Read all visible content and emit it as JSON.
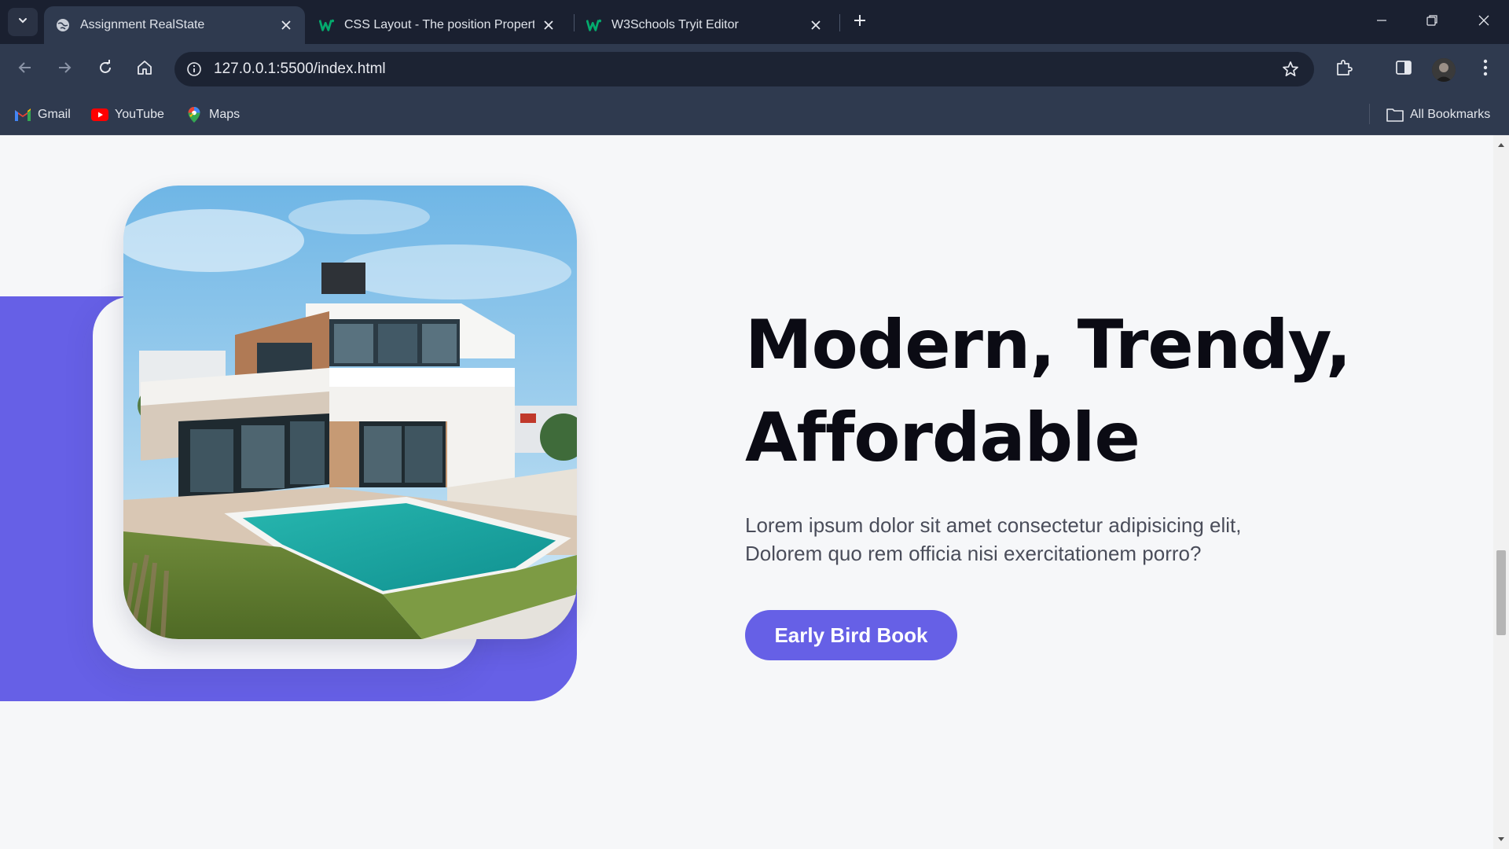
{
  "browser": {
    "tabs": [
      {
        "title": "Assignment RealState",
        "icon": "globe-icon",
        "active": true
      },
      {
        "title": "CSS Layout - The position Property",
        "icon": "w3schools-icon",
        "active": false
      },
      {
        "title": "W3Schools Tryit Editor",
        "icon": "w3schools-icon",
        "active": false
      }
    ],
    "address": "127.0.0.1:5500/index.html",
    "bookmarks": [
      {
        "label": "Gmail",
        "icon": "gmail-icon"
      },
      {
        "label": "YouTube",
        "icon": "youtube-icon"
      },
      {
        "label": "Maps",
        "icon": "maps-icon"
      }
    ],
    "all_bookmarks": "All Bookmarks"
  },
  "hero": {
    "headline_line1": "Modern, Trendy,",
    "headline_line2": "Affordable",
    "lead_line1": "Lorem ipsum dolor sit amet consectetur adipisicing elit,",
    "lead_line2": "Dolorem quo rem officia nisi exercitationem porro?",
    "cta_label": "Early Bird Book"
  },
  "colors": {
    "accent": "#6660e6",
    "page_bg": "#f6f7f9",
    "chrome_bg": "#2f3a4f",
    "tabstrip_bg": "#1a2030"
  }
}
